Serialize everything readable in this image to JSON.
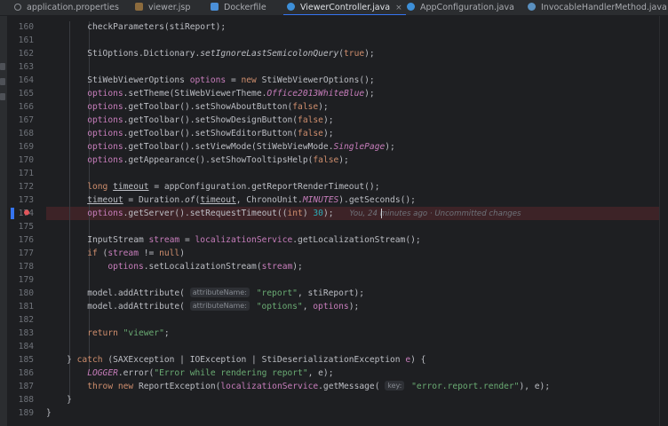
{
  "tabs": [
    {
      "label": "application.properties",
      "icon": "gear-icon",
      "active": false
    },
    {
      "label": "viewer.jsp",
      "icon": "jsp-file-icon",
      "active": false
    },
    {
      "label": "Dockerfile",
      "icon": "docker-icon",
      "active": false
    },
    {
      "label": "ViewerController.java",
      "icon": "java-class-icon",
      "active": true,
      "close": "×"
    },
    {
      "label": "AppConfiguration.java",
      "icon": "java-class-icon",
      "active": false
    },
    {
      "label": "InvocableHandlerMethod.java",
      "icon": "java-class-library-icon",
      "active": false
    }
  ],
  "colors": {
    "keyword": "#cf8e6d",
    "method": "#56a8f5",
    "field": "#c77dbb",
    "string": "#6aab73",
    "number": "#2aacb8",
    "highlight": "#3d2327",
    "accent": "#3574f0"
  },
  "lines": [
    {
      "n": "160",
      "t": [
        [
          "        ",
          ""
        ],
        [
          "checkParameters",
          "f0"
        ],
        [
          "(stiReport);",
          ""
        ]
      ]
    },
    {
      "n": "161",
      "t": []
    },
    {
      "n": "162",
      "t": [
        [
          "        StiOptions.Dictionary.",
          ""
        ],
        [
          "setIgnoreLastSemicolonQuery",
          "m"
        ],
        [
          "(",
          ""
        ],
        [
          "true",
          "k"
        ],
        [
          ");",
          ""
        ]
      ]
    },
    {
      "n": "163",
      "t": []
    },
    {
      "n": "164",
      "t": [
        [
          "        StiWebViewerOptions ",
          ""
        ],
        [
          "options",
          "v"
        ],
        [
          " = ",
          ""
        ],
        [
          "new ",
          "k"
        ],
        [
          "StiWebViewerOptions();",
          ""
        ]
      ]
    },
    {
      "n": "165",
      "t": [
        [
          "        ",
          ""
        ],
        [
          "options",
          "v"
        ],
        [
          ".setTheme(StiWebViewerTheme.",
          ""
        ],
        [
          "Office2013WhiteBlue",
          "fi"
        ],
        [
          ");",
          ""
        ]
      ]
    },
    {
      "n": "166",
      "t": [
        [
          "        ",
          ""
        ],
        [
          "options",
          "v"
        ],
        [
          ".getToolbar().setShowAboutButton(",
          ""
        ],
        [
          "false",
          "k"
        ],
        [
          ");",
          ""
        ]
      ]
    },
    {
      "n": "167",
      "t": [
        [
          "        ",
          ""
        ],
        [
          "options",
          "v"
        ],
        [
          ".getToolbar().setShowDesignButton(",
          ""
        ],
        [
          "false",
          "k"
        ],
        [
          ");",
          ""
        ]
      ]
    },
    {
      "n": "168",
      "t": [
        [
          "        ",
          ""
        ],
        [
          "options",
          "v"
        ],
        [
          ".getToolbar().setShowEditorButton(",
          ""
        ],
        [
          "false",
          "k"
        ],
        [
          ");",
          ""
        ]
      ]
    },
    {
      "n": "169",
      "t": [
        [
          "        ",
          ""
        ],
        [
          "options",
          "v"
        ],
        [
          ".getToolbar().setViewMode(StiWebViewMode.",
          ""
        ],
        [
          "SinglePage",
          "fi"
        ],
        [
          ");",
          ""
        ]
      ]
    },
    {
      "n": "170",
      "t": [
        [
          "        ",
          ""
        ],
        [
          "options",
          "v"
        ],
        [
          ".getAppearance().setShowTooltipsHelp(",
          ""
        ],
        [
          "false",
          "k"
        ],
        [
          ");",
          ""
        ]
      ]
    },
    {
      "n": "171",
      "t": []
    },
    {
      "n": "172",
      "t": [
        [
          "        ",
          ""
        ],
        [
          "long ",
          "k"
        ],
        [
          "timeout",
          "u"
        ],
        [
          " = appConfiguration.getReportRenderTimeout();",
          ""
        ]
      ]
    },
    {
      "n": "173",
      "t": [
        [
          "        ",
          ""
        ],
        [
          "timeout",
          "u"
        ],
        [
          " = Duration.",
          ""
        ],
        [
          "of",
          "m"
        ],
        [
          "(",
          ""
        ],
        [
          "timeout",
          "u"
        ],
        [
          ", ChronoUnit.",
          ""
        ],
        [
          "MINUTES",
          "fi"
        ],
        [
          ").getSeconds();",
          ""
        ]
      ]
    },
    {
      "n": "174",
      "t": [
        [
          "        ",
          ""
        ],
        [
          "options",
          "v"
        ],
        [
          ".getServer().setRequestTimeout((",
          ""
        ],
        [
          "int",
          "k"
        ],
        [
          ") ",
          ""
        ],
        [
          "30",
          "n"
        ],
        [
          ");",
          ""
        ]
      ],
      "blame": "You, 24 minutes ago · Uncommitted changes",
      "highlight": true
    },
    {
      "n": "175",
      "t": []
    },
    {
      "n": "176",
      "t": [
        [
          "        InputStream ",
          ""
        ],
        [
          "stream",
          "v"
        ],
        [
          " = ",
          ""
        ],
        [
          "localizationService",
          "v"
        ],
        [
          ".getLocalizationStream();",
          ""
        ]
      ]
    },
    {
      "n": "177",
      "t": [
        [
          "        ",
          ""
        ],
        [
          "if ",
          "k"
        ],
        [
          "(",
          ""
        ],
        [
          "stream",
          "v"
        ],
        [
          " != ",
          ""
        ],
        [
          "null",
          "k"
        ],
        [
          ")",
          ""
        ]
      ]
    },
    {
      "n": "178",
      "t": [
        [
          "            ",
          ""
        ],
        [
          "options",
          "v"
        ],
        [
          ".setLocalizationStream(",
          ""
        ],
        [
          "stream",
          "v"
        ],
        [
          ");",
          ""
        ]
      ]
    },
    {
      "n": "179",
      "t": []
    },
    {
      "n": "180",
      "t": [
        [
          "        model.addAttribute( ",
          ""
        ],
        [
          "attributeName:",
          "hint"
        ],
        [
          " ",
          ""
        ],
        [
          "\"report\"",
          "s"
        ],
        [
          ", stiReport);",
          ""
        ]
      ]
    },
    {
      "n": "181",
      "t": [
        [
          "        model.addAttribute( ",
          ""
        ],
        [
          "attributeName:",
          "hint"
        ],
        [
          " ",
          ""
        ],
        [
          "\"options\"",
          "s"
        ],
        [
          ", ",
          ""
        ],
        [
          "options",
          "v"
        ],
        [
          ");",
          ""
        ]
      ]
    },
    {
      "n": "182",
      "t": []
    },
    {
      "n": "183",
      "t": [
        [
          "        ",
          ""
        ],
        [
          "return ",
          "k"
        ],
        [
          "\"viewer\"",
          "s"
        ],
        [
          ";",
          ""
        ]
      ]
    },
    {
      "n": "184",
      "t": []
    },
    {
      "n": "185",
      "t": [
        [
          "    } ",
          ""
        ],
        [
          "catch ",
          "k"
        ],
        [
          "(SAXException | IOException | StiDeserializationException ",
          ""
        ],
        [
          "e",
          "v"
        ],
        [
          ") {",
          ""
        ]
      ]
    },
    {
      "n": "186",
      "t": [
        [
          "        ",
          ""
        ],
        [
          "LOGGER",
          "sfi"
        ],
        [
          ".error(",
          ""
        ],
        [
          "\"Error while rendering report\"",
          "s"
        ],
        [
          ", e);",
          ""
        ]
      ]
    },
    {
      "n": "187",
      "t": [
        [
          "        ",
          ""
        ],
        [
          "throw new ",
          "k"
        ],
        [
          "ReportException(",
          ""
        ],
        [
          "localizationService",
          "v"
        ],
        [
          ".getMessage( ",
          ""
        ],
        [
          "key:",
          "hint"
        ],
        [
          " ",
          ""
        ],
        [
          "\"error.report.render\"",
          "s"
        ],
        [
          "), e);",
          ""
        ]
      ]
    },
    {
      "n": "188",
      "t": [
        [
          "    }",
          ""
        ]
      ]
    },
    {
      "n": "189",
      "t": [
        [
          "}",
          ""
        ]
      ]
    }
  ]
}
